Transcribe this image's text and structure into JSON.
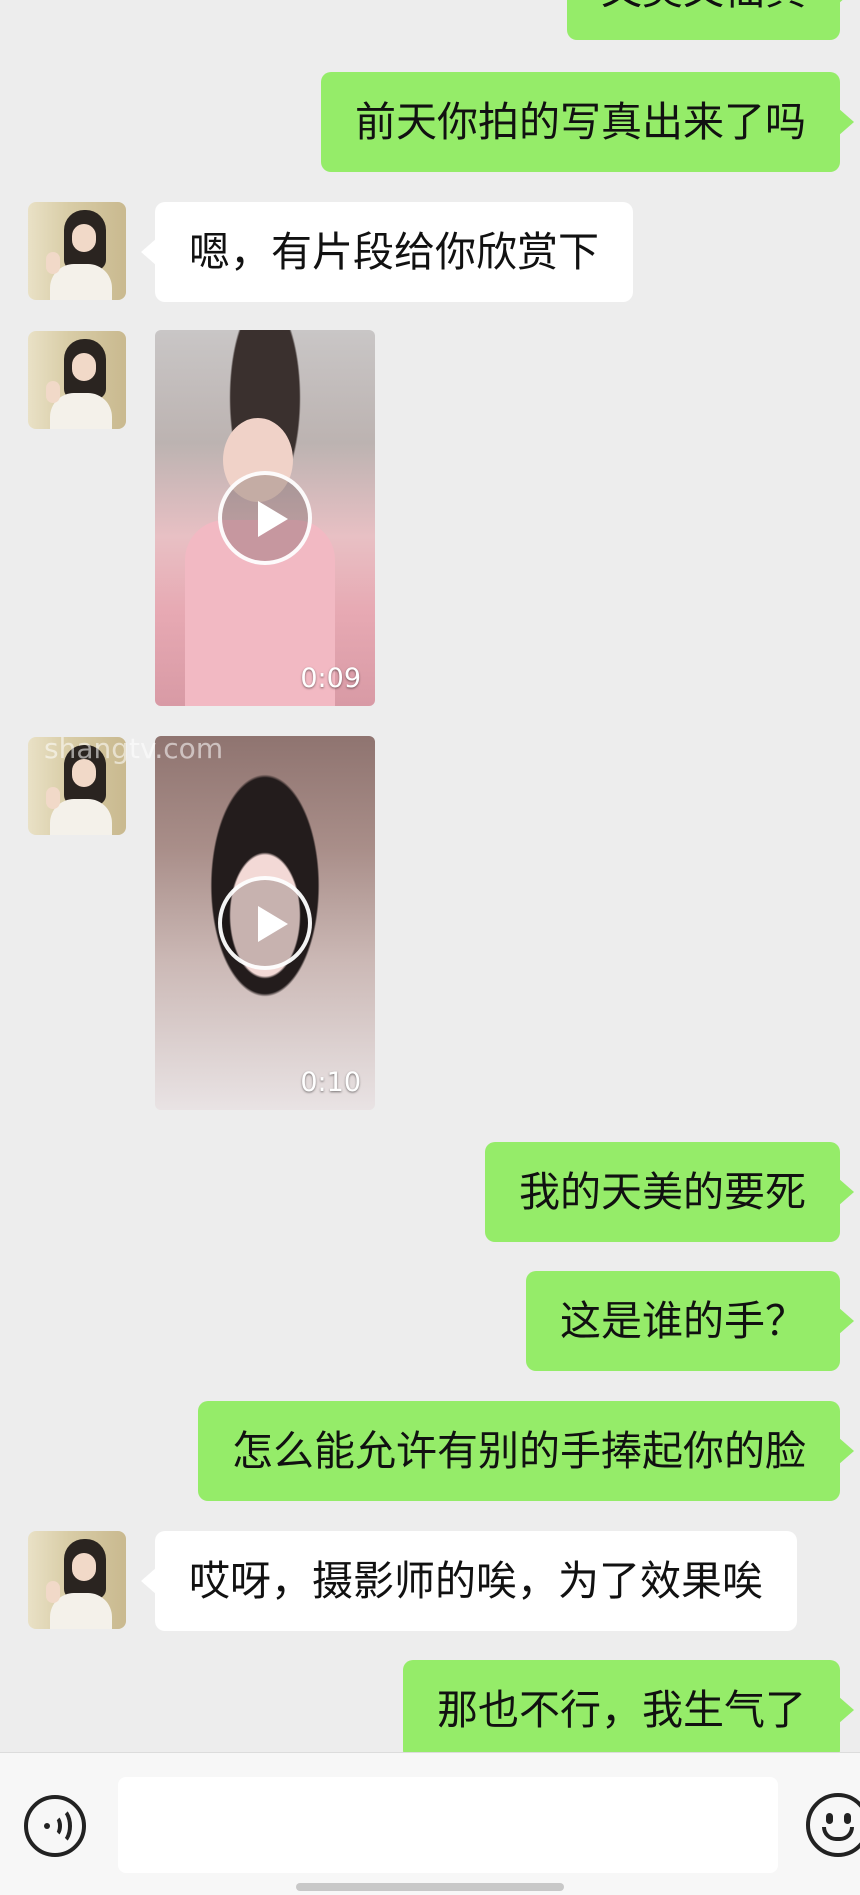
{
  "messages": [
    {
      "type": "text",
      "direction": "out",
      "text": "又美又仙真"
    },
    {
      "type": "text",
      "direction": "out",
      "text": "前天你拍的写真出来了吗"
    },
    {
      "type": "text",
      "direction": "in",
      "text": "嗯，有片段给你欣赏下"
    },
    {
      "type": "video",
      "direction": "in",
      "duration": "0:09"
    },
    {
      "type": "video",
      "direction": "in",
      "duration": "0:10"
    },
    {
      "type": "text",
      "direction": "out",
      "text": "我的天美的要死"
    },
    {
      "type": "text",
      "direction": "out",
      "text": "这是谁的手？"
    },
    {
      "type": "text",
      "direction": "out",
      "text": "怎么能允许有别的手捧起你的脸"
    },
    {
      "type": "text",
      "direction": "in",
      "text": "哎呀，摄影师的唉，为了效果唉"
    },
    {
      "type": "text",
      "direction": "out",
      "text": "那也不行，我生气了"
    }
  ],
  "watermark": "shangtv.com",
  "input": {
    "value": "",
    "placeholder": ""
  },
  "icons": {
    "voice": "voice-input-icon",
    "emoji": "emoji-icon",
    "play": "play-icon"
  },
  "colors": {
    "background": "#ededed",
    "outgoing_bubble": "#95ec69",
    "incoming_bubble": "#ffffff",
    "input_bar": "#f7f7f7"
  }
}
